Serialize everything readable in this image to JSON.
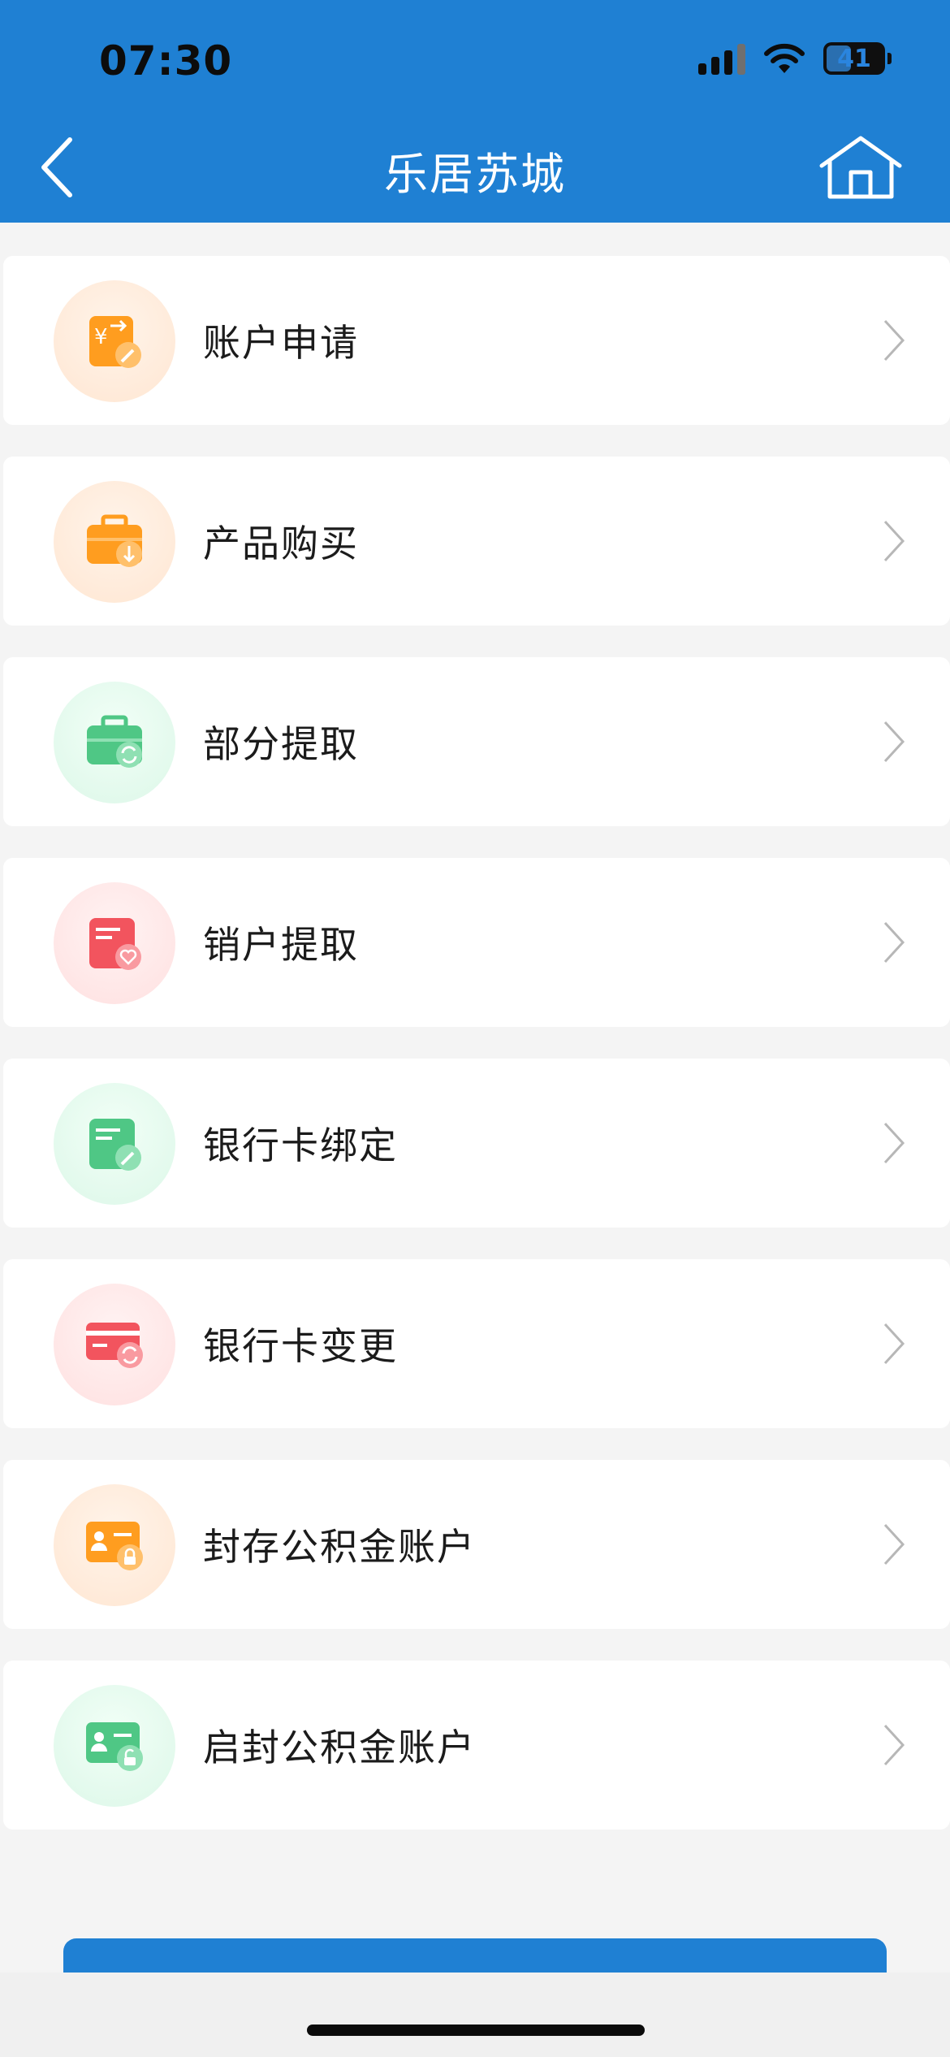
{
  "status_bar": {
    "time": "07:30",
    "battery_level": "41",
    "icons": [
      "signal-icon",
      "wifi-icon",
      "battery-icon"
    ]
  },
  "nav": {
    "title": "乐居苏城",
    "back_icon": "back-arrow-icon",
    "home_icon": "home-icon"
  },
  "colors": {
    "header_bg": "#1f80d3",
    "page_bg": "#f4f4f4",
    "orange": "#ff9d1f",
    "green": "#4fc785",
    "red": "#f2545e"
  },
  "menu": [
    {
      "label": "账户申请",
      "icon": "account-apply-icon",
      "color": "orange"
    },
    {
      "label": "产品购买",
      "icon": "product-purchase-icon",
      "color": "orange"
    },
    {
      "label": "部分提取",
      "icon": "partial-withdraw-icon",
      "color": "green"
    },
    {
      "label": "销户提取",
      "icon": "close-account-withdraw-icon",
      "color": "red"
    },
    {
      "label": "银行卡绑定",
      "icon": "bank-card-bind-icon",
      "color": "green"
    },
    {
      "label": "银行卡变更",
      "icon": "bank-card-change-icon",
      "color": "red"
    },
    {
      "label": "封存公积金账户",
      "icon": "seal-account-icon",
      "color": "orange"
    },
    {
      "label": "启封公积金账户",
      "icon": "unseal-account-icon",
      "color": "green"
    }
  ]
}
